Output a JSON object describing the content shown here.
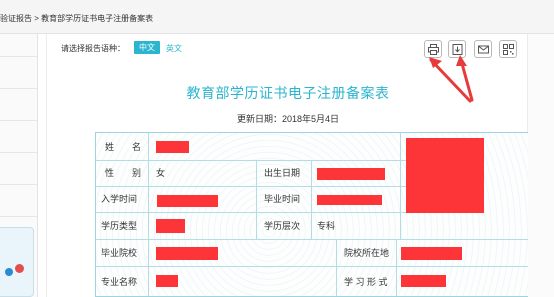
{
  "breadcrumb": "验证报告 > 教育部学历证书电子注册备案表",
  "language": {
    "label": "请选择报告语种：",
    "chinese": "中文",
    "english": "英文"
  },
  "toolbar": {
    "icons": [
      "printer-icon",
      "download-icon",
      "mail-icon",
      "qrcode-icon"
    ]
  },
  "report": {
    "title": "教育部学历证书电子注册备案表",
    "update_date": "更新日期：2018年5月4日",
    "rows": {
      "name_label": "姓　　名",
      "gender_label": "性　　别",
      "gender_value": "女",
      "birth_label": "出生日期",
      "enroll_label": "入学时间",
      "graduate_label": "毕业时间",
      "edu_type_label": "学历类型",
      "edu_level_label": "学历层次",
      "edu_level_value": "专科",
      "school_label": "毕业院校",
      "school_loc_label": "院校所在地",
      "major_label": "专业名称",
      "study_form_label": "学 习 形 式"
    }
  },
  "colors": {
    "accent": "#2bb5cf",
    "redaction": "#fe3538",
    "annotation": "#e63b3b"
  }
}
